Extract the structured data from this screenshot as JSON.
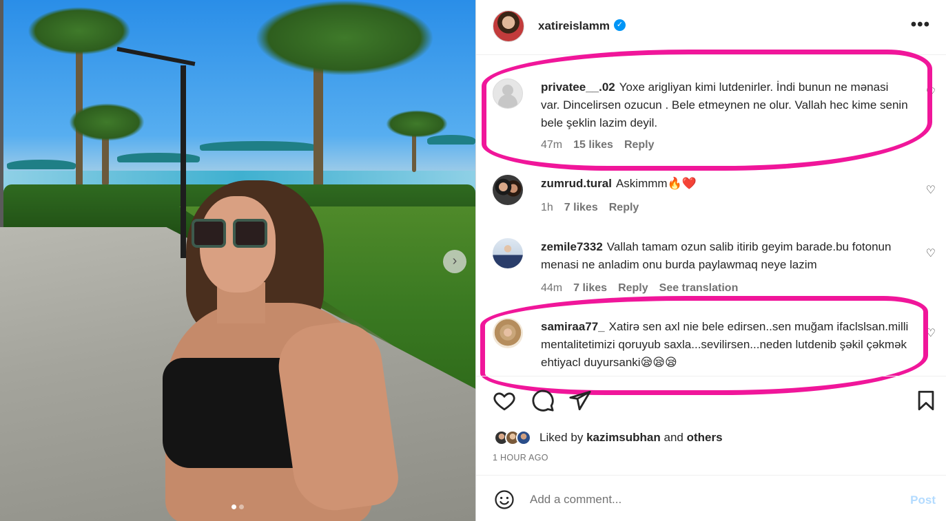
{
  "post": {
    "username": "xatireislamm",
    "more_label": "•••",
    "carousel_next": "›",
    "carousel_dots": 2,
    "carousel_active": 1
  },
  "comments": [
    {
      "username": "privatee__.02",
      "text": "Yoxe arigliyan kimi lutdenirler. İndi bunun ne mənasi var. Dincelirsen ozucun . Bele etmeynen ne olur. Vallah hec kime senin bele şeklin lazim deyil.",
      "time": "47m",
      "likes": "15 likes",
      "reply": "Reply"
    },
    {
      "username": "zumrud.tural",
      "text": "Askimmm🔥❤️",
      "time": "1h",
      "likes": "7 likes",
      "reply": "Reply"
    },
    {
      "username": "zemile7332",
      "text": "Vallah tamam ozun salib itirib geyim barade.bu fotonun menasi ne anladim onu burda paylawmaq neye lazim",
      "time": "44m",
      "likes": "7 likes",
      "reply": "Reply",
      "translation": "See translation"
    },
    {
      "username": "samiraa77_",
      "text": "Xatirə sen axl nie bele edirsen..sen muğam ifaclslsan.milli mentalitetimizi qoruyub saxla...sevilirsen...neden lutdenib şəkil çəkmək ehtiyacl duyursanki😪😪😪",
      "time": "",
      "likes": "",
      "reply": ""
    }
  ],
  "likes_line": {
    "prefix": "Liked by",
    "user": "kazimsubhan",
    "middle": "and",
    "others": "others"
  },
  "timestamp": "1 HOUR AGO",
  "add_comment": {
    "placeholder": "Add a comment...",
    "post_label": "Post"
  },
  "colors": {
    "highlight": "#f0169a",
    "verified": "#0095f6",
    "post_disabled": "#b3dbff"
  }
}
